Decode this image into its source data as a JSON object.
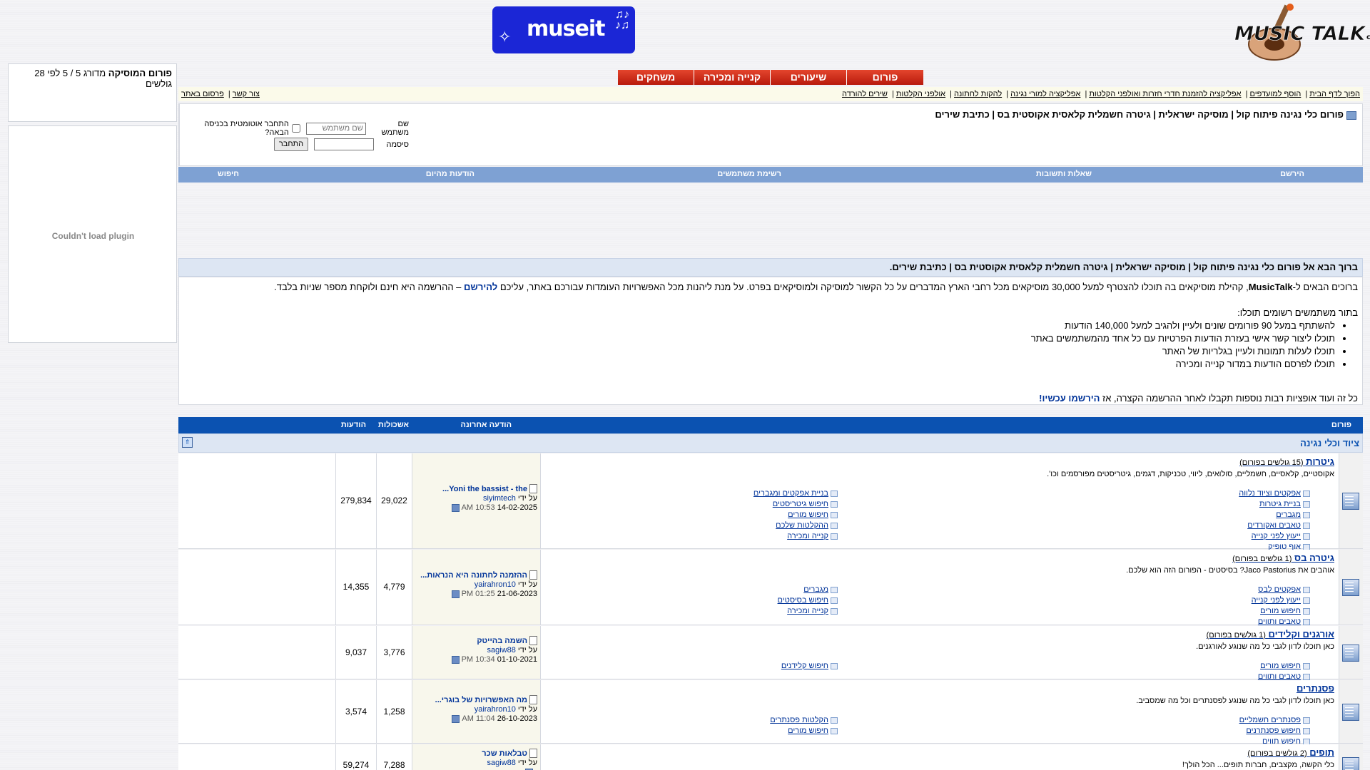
{
  "header": {
    "logo_text": "MUSICTALK.co.il",
    "banner_text": "museit"
  },
  "tabs": [
    "פורום",
    "שיעורים",
    "קנייה ומכירה",
    "משחקים"
  ],
  "toplinks": {
    "right": [
      "הפוך לדף הבית",
      "הוסף למועדפים",
      "אפליקציה להזמנת חדרי חזרות ואולפני הקלטות",
      "אפליקציה למורי נגינה",
      "להקות לחתונה",
      "אולפני הקלטות",
      "שירים להורדה"
    ],
    "left": [
      "צור קשר",
      "פרסום באתר"
    ]
  },
  "infobox": {
    "title": "פורום כלי נגינה פיתוח קול | מוסיקה ישראלית | גיטרה חשמלית קלאסית אקוסטית בס | כתיבת שירים",
    "login": {
      "username_label": "שם משתמש",
      "username_placeholder": "שם משתמש",
      "remember_label": "התחבר אוטומטית בכניסה הבאה?",
      "password_label": "סיסמה",
      "login_button": "התחבר"
    }
  },
  "navbar": [
    "הירשם",
    "שאלות ותשובות",
    "רשימת משתמשים",
    "הודעות מהיום",
    "חיפוש"
  ],
  "sidebar": {
    "rating_title": "פורום המוסיקה",
    "rating_text": "מדורג 5 / 5 לפי 28 גולשים",
    "plugin_text": "Couldn't load plugin"
  },
  "welcome": {
    "heading": "ברוך הבא אל פורום כלי נגינה פיתוח קול | מוסיקה ישראלית | גיטרה חשמלית קלאסית אקוסטית בס | כתיבת שירים.",
    "intro_before": "ברוכים הבאים ל-",
    "intro_brand": "MusicTalk",
    "intro_middle": ", קהילת מוסיקאים בה תוכלו להצטרף למעל 30,000 מוסיקאים מכל רחבי הארץ המדברים על כל הקשור למוסיקה ולמוסיקאים בפרט. על מנת ליהנות מכל האפשרויות העומדות עבורכם באתר, עליכם",
    "intro_link": "להירשם",
    "intro_after": "– ההרשמה היא חינם ולוקחת מספר שניות בלבד.",
    "list_title": "בתור משתמשים רשומים תוכלו:",
    "list": [
      "להשתתף במעל 90 פורומים שונים ולעיין ולהגיב למעל 140,000 הודעות",
      "תוכלו ליצור קשר אישי בעזרת הודעות הפרטיות עם כל אחד מהמשתמשים באתר",
      "תוכלו לעלות תמונות ולעיין בגלריות של האתר",
      "תוכלו לפרסם הודעות במדור קנייה ומכירה"
    ],
    "closing": "כל זה ועוד אופציות רבות נוספות תקבלו לאחר ההרשמה הקצרה, אז",
    "closing_link": "הירשמו עכשיו!"
  },
  "table": {
    "headers": {
      "forum": "פורום",
      "last_post": "הודעה אחרונה",
      "threads": "אשכולות",
      "posts": "הודעות"
    },
    "category": "ציוד וכלי נגינה",
    "collapse_icon": "collapse-icon",
    "forums": [
      {
        "name": "גיטרות",
        "note": "(15 גולשים בפורום)",
        "desc": "אקוסטיים, קלאסיים, חשמליים, סולואים, ליווי, טכניקות, דגמים, גיטריסטים מפורסמים וכו'.",
        "subs_right": [
          "אפקטים וציוד נלווה",
          "בניית גיטרות",
          "מגברים",
          "טאבים ואקורדים",
          "ייעוץ לפני קנייה",
          "אוף טופיק"
        ],
        "subs_left": [
          "בניית אפקטים ומגברים",
          "חיפוש גיטריסטים",
          "חיפוש מורים",
          "ההקלטות שלכם",
          "קנייה ומכירה"
        ],
        "last_title": "Yoni the bassist - the...",
        "last_by_label": "על ידי",
        "last_user": "siyimtech",
        "last_date": "14-02-2025",
        "last_time": "10:53 AM",
        "threads": "29,022",
        "posts": "279,834"
      },
      {
        "name": "גיטרה בס",
        "note": "(1 גולשים בפורום)",
        "desc": "אוהבים את Jaco Pastorius? בסיסטים - הפורום הזה הוא שלכם.",
        "subs_right": [
          "אפקטים לבס",
          "ייעוץ לפני קנייה",
          "חיפוש מורים",
          "טאבים ותווים"
        ],
        "subs_left": [
          "מגברים",
          "חיפוש בסיסטים",
          "קנייה ומכירה"
        ],
        "last_title": "ההזמנה לחתונה היא הנראות...",
        "last_by_label": "על ידי",
        "last_user": "yairahron10",
        "last_date": "21-06-2023",
        "last_time": "01:25 PM",
        "threads": "4,779",
        "posts": "14,355"
      },
      {
        "name": "אורגנים וקלידים",
        "note": "(1 גולשים בפורום)",
        "desc": "כאן תוכלו לדון לגבי כל מה שנוגע לאורגנים.",
        "subs_right": [
          "חיפוש מורים",
          "טאבים ותווים"
        ],
        "subs_left": [
          "חיפוש קלידנים"
        ],
        "last_title": "השמה בהייטק",
        "last_by_label": "על ידי",
        "last_user": "sagiw88",
        "last_date": "01-10-2021",
        "last_time": "10:34 PM",
        "threads": "3,776",
        "posts": "9,037"
      },
      {
        "name": "פסנתרים",
        "note": "",
        "desc": "כאן תוכלו לדון לגבי כל מה שנוגע לפסנתרים וכל מה שמסביב.",
        "subs_right": [
          "פסנתרים חשמליים",
          "חיפוש פסנתרנים",
          "חיפוש תווים"
        ],
        "subs_left": [
          "הקלטות פסנתרים",
          "חיפוש מורים"
        ],
        "last_title": "מה האפשרויות של בוגרי...",
        "last_by_label": "על ידי",
        "last_user": "yairahron10",
        "last_date": "26-10-2023",
        "last_time": "11:04 AM",
        "threads": "1,258",
        "posts": "3,574"
      },
      {
        "name": "תופים",
        "note": "(2 גולשים בפורום)",
        "desc": "כלי הקשה, מקצבים, חברות תופים... הכל הולך!",
        "subs_right": [],
        "subs_left": [],
        "last_title": "טבלאות שכר",
        "last_by_label": "על ידי",
        "last_user": "sagiw88",
        "last_date": "",
        "last_time": "",
        "threads": "7,288",
        "posts": "59,274"
      }
    ]
  }
}
